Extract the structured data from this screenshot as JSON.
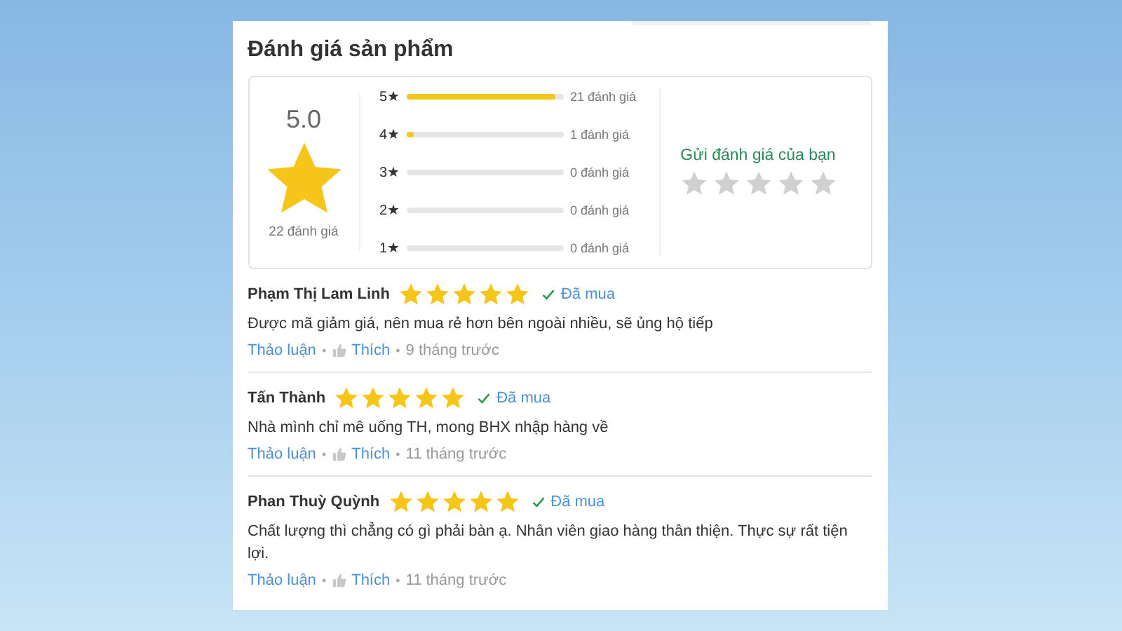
{
  "title": "Đánh giá sản phẩm",
  "separator": "•",
  "summary": {
    "average": "5.0",
    "total": "22 đánh giá",
    "bars": [
      {
        "label": "5★",
        "level": 0.95,
        "count": "21 đánh giá"
      },
      {
        "label": "4★",
        "level": 0.05,
        "count": "1 đánh giá"
      },
      {
        "label": "3★",
        "count": "0 đánh giá"
      },
      {
        "label": "2★",
        "count": "0 đánh giá"
      },
      {
        "label": "1★",
        "count": "0 đánh giá"
      }
    ],
    "submit": {
      "label": "Gửi đánh giá của bạn",
      "stars": 0
    }
  },
  "reviews": [
    {
      "name": "Phạm Thị Lam Linh",
      "stars": 5,
      "purchased": "Đã mua",
      "text": "Được mã giảm giá, nên mua rẻ hơn bên ngoài nhiều, sẽ ủng hộ tiếp",
      "discuss": "Thảo luận",
      "like": "Thích",
      "time": "9 tháng trước"
    },
    {
      "name": "Tấn Thành",
      "stars": 5,
      "purchased": "Đã mua",
      "text": "Nhà mình chỉ mê uống TH, mong BHX nhập hàng về",
      "discuss": "Thảo luận",
      "like": "Thích",
      "time": "11 tháng trước"
    },
    {
      "name": "Phan Thuỳ Quỳnh",
      "stars": 5,
      "purchased": "Đã mua",
      "text": "Chất lượng thì chẳng có gì phải bàn ạ. Nhân viên giao hàng thân thiện. Thực sự rất tiện lợi.",
      "discuss": "Thảo luận",
      "like": "Thích",
      "time": "11 tháng trước"
    }
  ]
}
